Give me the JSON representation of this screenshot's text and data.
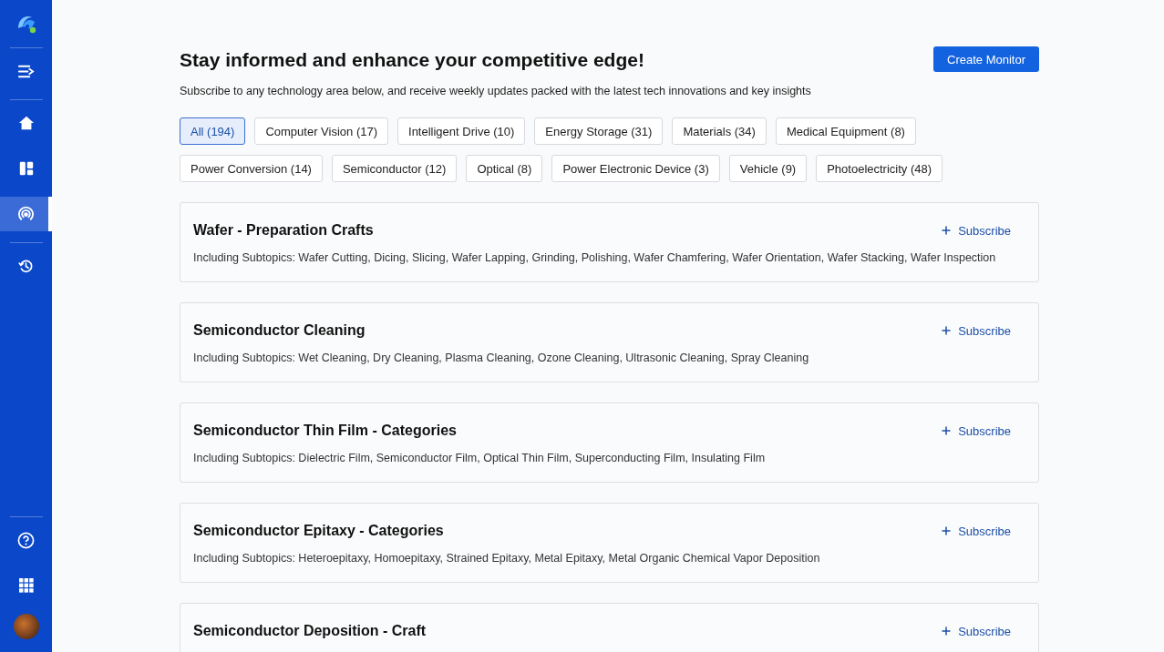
{
  "sidebar": {
    "nav": [
      {
        "kind": "collapse",
        "selected": false
      },
      {
        "kind": "home",
        "selected": false
      },
      {
        "kind": "board",
        "selected": false
      },
      {
        "kind": "radar",
        "selected": true
      },
      {
        "kind": "history",
        "selected": false
      }
    ],
    "bottom": [
      {
        "kind": "help"
      },
      {
        "kind": "apps"
      },
      {
        "kind": "avatar"
      }
    ]
  },
  "header": {
    "title": "Stay informed and enhance your competitive edge!",
    "subtitle": "Subscribe to any technology area below, and receive weekly updates packed with the latest tech innovations and key insights",
    "action": "Create Monitor"
  },
  "filters": [
    {
      "label": "All (194)",
      "selected": true
    },
    {
      "label": "Computer Vision (17)",
      "selected": false
    },
    {
      "label": "Intelligent Drive (10)",
      "selected": false
    },
    {
      "label": "Energy Storage (31)",
      "selected": false
    },
    {
      "label": "Materials (34)",
      "selected": false
    },
    {
      "label": "Medical Equipment (8)",
      "selected": false
    },
    {
      "label": "Power Conversion (14)",
      "selected": false
    },
    {
      "label": "Semiconductor (12)",
      "selected": false
    },
    {
      "label": "Optical (8)",
      "selected": false
    },
    {
      "label": "Power Electronic Device (3)",
      "selected": false
    },
    {
      "label": "Vehicle (9)",
      "selected": false
    },
    {
      "label": "Photoelectricity (48)",
      "selected": false
    }
  ],
  "topics": [
    {
      "title": "Wafer - Preparation Crafts",
      "subtopics": "Including Subtopics: Wafer Cutting, Dicing, Slicing, Wafer Lapping, Grinding, Polishing, Wafer Chamfering, Wafer Orientation, Wafer Stacking, Wafer Inspection",
      "action": "Subscribe"
    },
    {
      "title": "Semiconductor Cleaning",
      "subtopics": "Including Subtopics: Wet Cleaning, Dry Cleaning, Plasma Cleaning, Ozone Cleaning, Ultrasonic Cleaning, Spray Cleaning",
      "action": "Subscribe"
    },
    {
      "title": "Semiconductor Thin Film - Categories",
      "subtopics": "Including Subtopics: Dielectric Film, Semiconductor Film, Optical Thin Film, Superconducting Film, Insulating Film",
      "action": "Subscribe"
    },
    {
      "title": "Semiconductor Epitaxy - Categories",
      "subtopics": "Including Subtopics: Heteroepitaxy, Homoepitaxy, Strained Epitaxy, Metal Epitaxy, Metal Organic Chemical Vapor Deposition",
      "action": "Subscribe"
    },
    {
      "title": "Semiconductor Deposition - Craft",
      "action": "Subscribe"
    }
  ]
}
